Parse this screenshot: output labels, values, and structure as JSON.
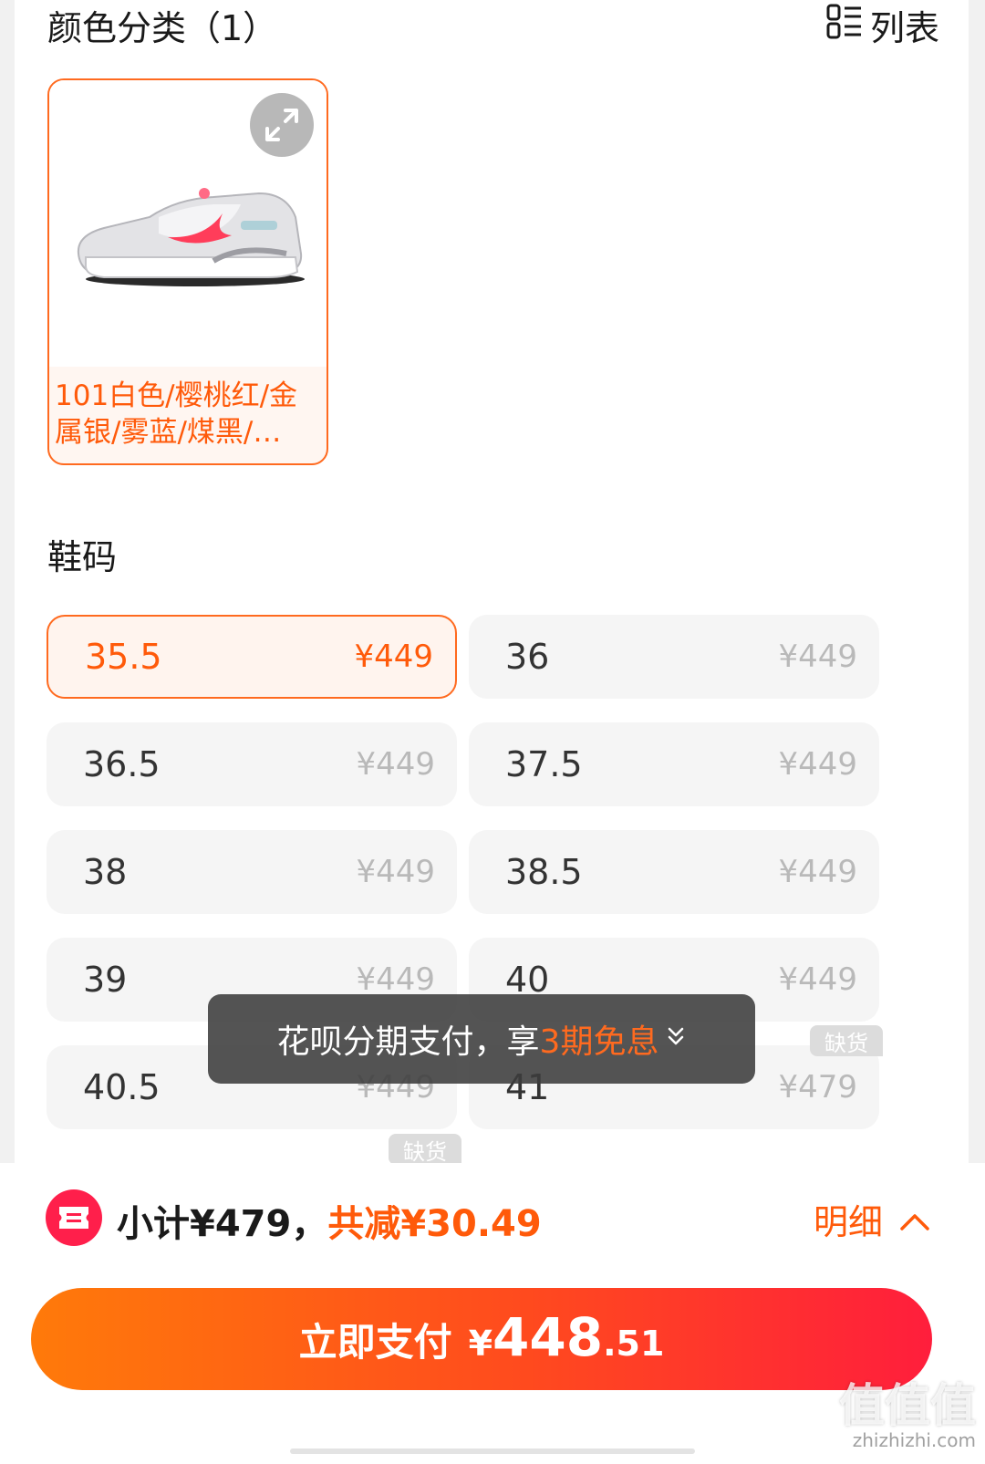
{
  "color_section": {
    "title": "颜色分类（1）",
    "view_toggle_label": "列表",
    "options": [
      {
        "label": "101白色/樱桃红/金属银/雾蓝/煤黑/…"
      }
    ]
  },
  "size_section": {
    "title": "鞋码",
    "sizes": [
      {
        "size": "35.5",
        "price": "¥449"
      },
      {
        "size": "36",
        "price": "¥449"
      },
      {
        "size": "36.5",
        "price": "¥449"
      },
      {
        "size": "37.5",
        "price": "¥449"
      },
      {
        "size": "38",
        "price": "¥449"
      },
      {
        "size": "38.5",
        "price": "¥449"
      },
      {
        "size": "39",
        "price": "¥449"
      },
      {
        "size": "40",
        "price": "¥449"
      },
      {
        "size": "40.5",
        "price": "¥449"
      },
      {
        "size": "41",
        "price": "¥479"
      }
    ],
    "selected_size": "35.5",
    "out_of_stock_label": "缺货"
  },
  "toast": {
    "prefix": "花呗分期支付，享",
    "highlight": "3期免息"
  },
  "summary": {
    "subtotal": "小计¥479，",
    "discount": "共减¥30.49",
    "detail_label": "明细"
  },
  "pay_button": {
    "label": "立即支付",
    "currency": "¥",
    "amount_int": "448",
    "amount_dec": ".51"
  },
  "watermark": {
    "main": "值值值",
    "sub": "zhizhizhi.com"
  },
  "colors": {
    "accent": "#ff5a0a",
    "pay_gradient_start": "#ff7a0a",
    "pay_gradient_end": "#ff1e3c",
    "coupon_red": "#ff1f4b"
  }
}
